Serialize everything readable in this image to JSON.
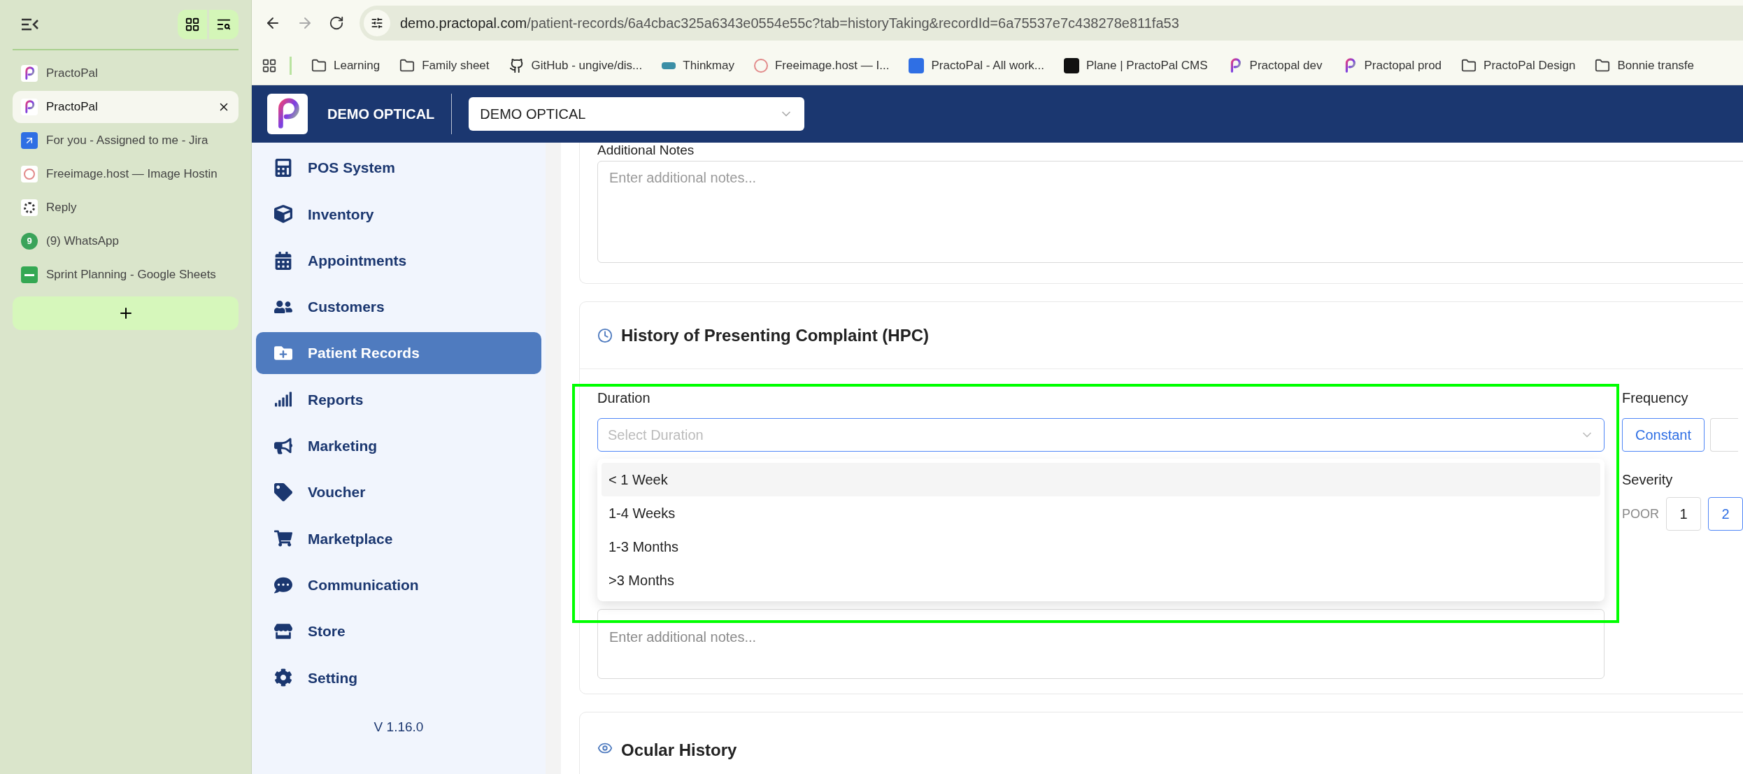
{
  "browser_tabs": [
    {
      "title": "PractoPal",
      "selected": false
    },
    {
      "title": "PractoPal",
      "selected": true
    },
    {
      "title": "For you - Assigned to me - Jira",
      "selected": false
    },
    {
      "title": "Freeimage.host — Image Hostin",
      "selected": false
    },
    {
      "title": "Reply",
      "selected": false
    },
    {
      "title": "(9) WhatsApp",
      "selected": false,
      "badge": "9"
    },
    {
      "title": "Sprint Planning - Google Sheets",
      "selected": false
    }
  ],
  "address_bar": {
    "url_host": "demo.practopal.com",
    "url_path": "/patient-records/6a4cbac325a6343e0554e55c?tab=historyTaking&recordId=6a75537e7c438278e811fa53"
  },
  "bookmarks": [
    {
      "label": "Learning",
      "kind": "folder"
    },
    {
      "label": "Family sheet",
      "kind": "folder"
    },
    {
      "label": "GitHub - ungive/dis...",
      "kind": "github"
    },
    {
      "label": "Thinkmay",
      "kind": "thinkmay"
    },
    {
      "label": "Freeimage.host — I...",
      "kind": "freeimage"
    },
    {
      "label": "PractoPal - All work...",
      "kind": "jira"
    },
    {
      "label": "Plane | PractoPal CMS",
      "kind": "plane"
    },
    {
      "label": "Practopal dev",
      "kind": "practopal"
    },
    {
      "label": "Practopal prod",
      "kind": "practopal"
    },
    {
      "label": "PractoPal Design",
      "kind": "folder"
    },
    {
      "label": "Bonnie transfe",
      "kind": "folder"
    }
  ],
  "app_header": {
    "brand": "DEMO OPTICAL",
    "org_select": "DEMO OPTICAL"
  },
  "nav": [
    {
      "label": "POS System",
      "selected": false
    },
    {
      "label": "Inventory",
      "selected": false
    },
    {
      "label": "Appointments",
      "selected": false
    },
    {
      "label": "Customers",
      "selected": false
    },
    {
      "label": "Patient Records",
      "selected": true
    },
    {
      "label": "Reports",
      "selected": false
    },
    {
      "label": "Marketing",
      "selected": false
    },
    {
      "label": "Voucher",
      "selected": false
    },
    {
      "label": "Marketplace",
      "selected": false
    },
    {
      "label": "Communication",
      "selected": false
    },
    {
      "label": "Store",
      "selected": false
    },
    {
      "label": "Setting",
      "selected": false
    }
  ],
  "version": "V 1.16.0",
  "additional_notes": {
    "label": "Additional Notes",
    "placeholder": "Enter additional notes..."
  },
  "hpc": {
    "title": "History of Presenting Complaint (HPC)",
    "duration": {
      "label": "Duration",
      "placeholder": "Select Duration",
      "expanded": true,
      "options": [
        {
          "label": "< 1 Week",
          "highlighted": true
        },
        {
          "label": "1-4 Weeks",
          "highlighted": false
        },
        {
          "label": "1-3 Months",
          "highlighted": false
        },
        {
          "label": ">3 Months",
          "highlighted": false
        }
      ]
    },
    "frequency": {
      "label": "Frequency",
      "options": [
        {
          "label": "Constant",
          "selected": true
        }
      ]
    },
    "severity": {
      "label": "Severity",
      "low_label": "POOR",
      "scale": [
        {
          "label": "1",
          "selected": false
        },
        {
          "label": "2",
          "selected": true
        }
      ]
    },
    "notes_placeholder": "Enter additional notes..."
  },
  "ocular_history": {
    "title": "Ocular History"
  }
}
